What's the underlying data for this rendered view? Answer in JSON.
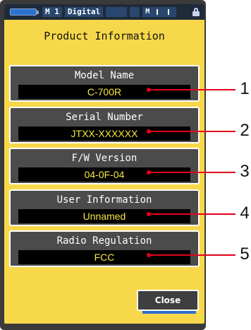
{
  "status_bar": {
    "mode_label": "M 1",
    "display_label": "Digital",
    "signal_label": "M"
  },
  "title": "Product Information",
  "info_panels": [
    {
      "label": "Model Name",
      "value": "C-700R",
      "callout": "1"
    },
    {
      "label": "Serial Number",
      "value": "JTXX-XXXXXX",
      "callout": "2"
    },
    {
      "label": "F/W Version",
      "value": "04-0F-04",
      "callout": "3"
    },
    {
      "label": "User Information",
      "value": "Unnamed",
      "callout": "4"
    },
    {
      "label": "Radio Regulation",
      "value": "FCC",
      "callout": "5"
    }
  ],
  "close_button": {
    "label": "Close"
  },
  "colors": {
    "screen_bg": "#f7d84a",
    "panel_bg": "#4b4b4b",
    "value_text": "#f7e640",
    "callout_line": "#e3001b"
  },
  "icons": [
    "battery-icon",
    "lock-icon"
  ]
}
